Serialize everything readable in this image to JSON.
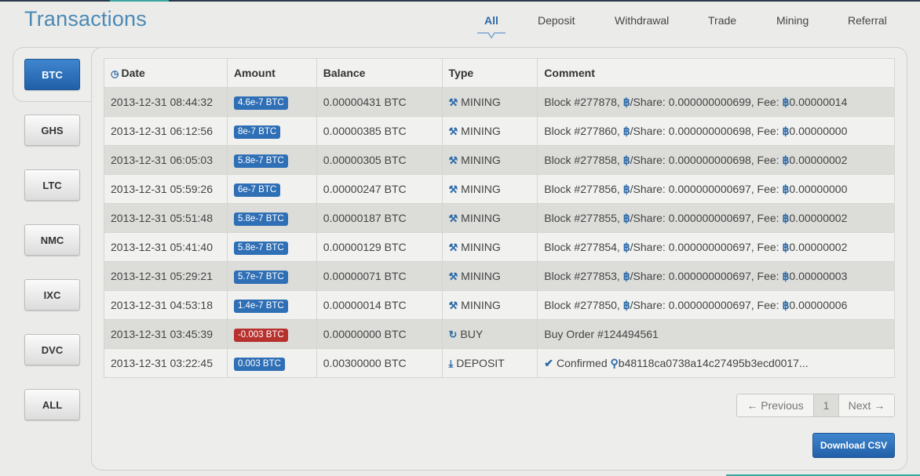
{
  "page": {
    "title": "Transactions"
  },
  "tabs": [
    {
      "label": "All",
      "active": true
    },
    {
      "label": "Deposit",
      "active": false
    },
    {
      "label": "Withdrawal",
      "active": false
    },
    {
      "label": "Trade",
      "active": false
    },
    {
      "label": "Mining",
      "active": false
    },
    {
      "label": "Referral",
      "active": false
    }
  ],
  "currencies": [
    {
      "label": "BTC",
      "active": true
    },
    {
      "label": "GHS",
      "active": false
    },
    {
      "label": "LTC",
      "active": false
    },
    {
      "label": "NMC",
      "active": false
    },
    {
      "label": "IXC",
      "active": false
    },
    {
      "label": "DVC",
      "active": false
    },
    {
      "label": "ALL",
      "active": false
    }
  ],
  "table": {
    "columns": [
      "Date",
      "Amount",
      "Balance",
      "Type",
      "Comment"
    ],
    "rows": [
      {
        "date": "2013-12-31 08:44:32",
        "amount": "4.6e-7 BTC",
        "negative": false,
        "balance": "0.00000431 BTC",
        "type": "MINING",
        "type_icon": "mining-icon",
        "block": "Block #277878,",
        "share": "/Share: 0.000000000699, Fee:",
        "fee": "0.00000014"
      },
      {
        "date": "2013-12-31 06:12:56",
        "amount": "8e-7 BTC",
        "negative": false,
        "balance": "0.00000385 BTC",
        "type": "MINING",
        "type_icon": "mining-icon",
        "block": "Block #277860,",
        "share": "/Share: 0.000000000698, Fee:",
        "fee": "0.00000000"
      },
      {
        "date": "2013-12-31 06:05:03",
        "amount": "5.8e-7 BTC",
        "negative": false,
        "balance": "0.00000305 BTC",
        "type": "MINING",
        "type_icon": "mining-icon",
        "block": "Block #277858,",
        "share": "/Share: 0.000000000698, Fee:",
        "fee": "0.00000002"
      },
      {
        "date": "2013-12-31 05:59:26",
        "amount": "6e-7 BTC",
        "negative": false,
        "balance": "0.00000247 BTC",
        "type": "MINING",
        "type_icon": "mining-icon",
        "block": "Block #277856,",
        "share": "/Share: 0.000000000697, Fee:",
        "fee": "0.00000000"
      },
      {
        "date": "2013-12-31 05:51:48",
        "amount": "5.8e-7 BTC",
        "negative": false,
        "balance": "0.00000187 BTC",
        "type": "MINING",
        "type_icon": "mining-icon",
        "block": "Block #277855,",
        "share": "/Share: 0.000000000697, Fee:",
        "fee": "0.00000002"
      },
      {
        "date": "2013-12-31 05:41:40",
        "amount": "5.8e-7 BTC",
        "negative": false,
        "balance": "0.00000129 BTC",
        "type": "MINING",
        "type_icon": "mining-icon",
        "block": "Block #277854,",
        "share": "/Share: 0.000000000697, Fee:",
        "fee": "0.00000002"
      },
      {
        "date": "2013-12-31 05:29:21",
        "amount": "5.7e-7 BTC",
        "negative": false,
        "balance": "0.00000071 BTC",
        "type": "MINING",
        "type_icon": "mining-icon",
        "block": "Block #277853,",
        "share": "/Share: 0.000000000697, Fee:",
        "fee": "0.00000003"
      },
      {
        "date": "2013-12-31 04:53:18",
        "amount": "1.4e-7 BTC",
        "negative": false,
        "balance": "0.00000014 BTC",
        "type": "MINING",
        "type_icon": "mining-icon",
        "block": "Block #277850,",
        "share": "/Share: 0.000000000697, Fee:",
        "fee": "0.00000006"
      },
      {
        "date": "2013-12-31 03:45:39",
        "amount": "-0.003 BTC",
        "negative": true,
        "balance": "0.00000000 BTC",
        "type": "BUY",
        "type_icon": "refresh-icon",
        "comment": "Buy Order #124494561"
      },
      {
        "date": "2013-12-31 03:22:45",
        "amount": "0.003 BTC",
        "negative": false,
        "balance": "0.00300000 BTC",
        "type": "DEPOSIT",
        "type_icon": "download-icon",
        "confirmed": "Confirmed",
        "tx_hash": "b48118ca0738a14c27495b3ecd0017..."
      }
    ]
  },
  "pager": {
    "prev": "← Previous",
    "page": "1",
    "next": "Next →"
  },
  "actions": {
    "download_csv": "Download CSV"
  },
  "colors": {
    "accent": "#2b6aa8",
    "badge": "#2f6fb5",
    "badge_negative": "#b7312d",
    "title": "#4a8ab5"
  }
}
